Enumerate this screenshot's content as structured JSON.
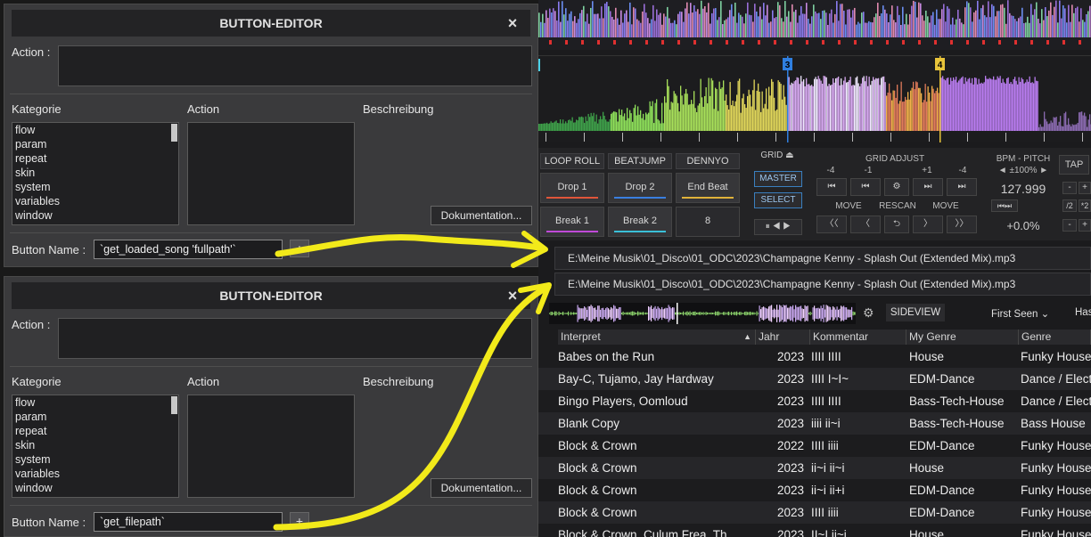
{
  "editors": [
    {
      "title": "BUTTON-EDITOR",
      "close": "×",
      "action_label": "Action :",
      "kategorie_label": "Kategorie",
      "action_col_label": "Action",
      "beschreibung_label": "Beschreibung",
      "categories": [
        "flow",
        "param",
        "repeat",
        "skin",
        "system",
        "variables",
        "window"
      ],
      "doc_button": "Dokumentation...",
      "button_name_label": "Button Name :",
      "button_name_value": "`get_loaded_song 'fullpath'`",
      "plus": "+"
    },
    {
      "title": "BUTTON-EDITOR",
      "close": "×",
      "action_label": "Action :",
      "kategorie_label": "Kategorie",
      "action_col_label": "Action",
      "beschreibung_label": "Beschreibung",
      "categories": [
        "flow",
        "param",
        "repeat",
        "skin",
        "system",
        "variables",
        "window"
      ],
      "doc_button": "Dokumentation...",
      "button_name_label": "Button Name :",
      "button_name_value": "`get_filepath`",
      "plus": "+"
    }
  ],
  "deck": {
    "cue_markers": [
      "3",
      "4"
    ],
    "pad_headers": [
      "LOOP ROLL",
      "BEATJUMP",
      "DENNYO"
    ],
    "pads": [
      {
        "label": "Drop 1",
        "color": "#e0553a"
      },
      {
        "label": "Drop 2",
        "color": "#3a7fe0"
      },
      {
        "label": "End Beat",
        "color": "#e0b23a"
      },
      {
        "label": "Break 1",
        "color": "#c04ad8"
      },
      {
        "label": "Break 2",
        "color": "#3ac0d8"
      },
      {
        "label": "8",
        "color": ""
      }
    ],
    "grid_label": "GRID",
    "master": "MASTER",
    "select": "SELECT",
    "grid_adjust": "GRID ADJUST",
    "grid_offsets": [
      "-4",
      "-1",
      "+1",
      "-4"
    ],
    "move_left": "MOVE",
    "rescan": "RESCAN",
    "move_right": "MOVE",
    "bpm_title": "BPM - PITCH",
    "pitch_range": "◄ ±100% ►",
    "bpm": "127.999",
    "pitch": "+0.0%",
    "tap": "TAP",
    "half": "/2",
    "double": "*2"
  },
  "file_paths": [
    "E:\\Meine Musik\\01_Disco\\01_ODC\\2023\\Champagne Kenny - Splash Out (Extended Mix).mp3",
    "E:\\Meine Musik\\01_Disco\\01_ODC\\2023\\Champagne Kenny - Splash Out (Extended Mix).mp3"
  ],
  "browser": {
    "sideview": "SIDEVIEW",
    "sort": "First Seen",
    "next_col": "Has",
    "columns": [
      "Interpret",
      "Jahr",
      "Kommentar",
      "My Genre",
      "Genre"
    ],
    "rows": [
      {
        "artist": "Babes on the Run",
        "year": "2023",
        "comment": "IIII    IIII",
        "mygenre": "House",
        "genre": "Funky House"
      },
      {
        "artist": "Bay-C, Tujamo, Jay Hardway",
        "year": "2023",
        "comment": "IIII    I~I~",
        "mygenre": "EDM-Dance",
        "genre": "Dance / Electro"
      },
      {
        "artist": "Bingo Players, Oomloud",
        "year": "2023",
        "comment": "IIII    IIII",
        "mygenre": "Bass-Tech-House",
        "genre": "Dance / Electro"
      },
      {
        "artist": "Blank Copy",
        "year": "2023",
        "comment": "iiii    ii~i",
        "mygenre": "Bass-Tech-House",
        "genre": "Bass House"
      },
      {
        "artist": "Block & Crown",
        "year": "2022",
        "comment": "IIII    iiii",
        "mygenre": "EDM-Dance",
        "genre": "Funky House"
      },
      {
        "artist": "Block & Crown",
        "year": "2023",
        "comment": "ii~i    ii~i",
        "mygenre": "House",
        "genre": "Funky House"
      },
      {
        "artist": "Block & Crown",
        "year": "2023",
        "comment": "ii~i    ii+i",
        "mygenre": "EDM-Dance",
        "genre": "Funky House"
      },
      {
        "artist": "Block & Crown",
        "year": "2023",
        "comment": "IIII    iiii",
        "mygenre": "EDM-Dance",
        "genre": "Funky House"
      },
      {
        "artist": "Block & Crown, Culum Frea, Th",
        "year": "2023",
        "comment": "II~I    ii~i",
        "mygenre": "House",
        "genre": "Funky House"
      }
    ]
  },
  "colors": {
    "annotation_arrow": "#f2ea1a",
    "wave_purple": "#b97cf0",
    "wave_green": "#8ee05a",
    "cue3": "#2f7fe0",
    "cue4": "#e8c43a"
  }
}
